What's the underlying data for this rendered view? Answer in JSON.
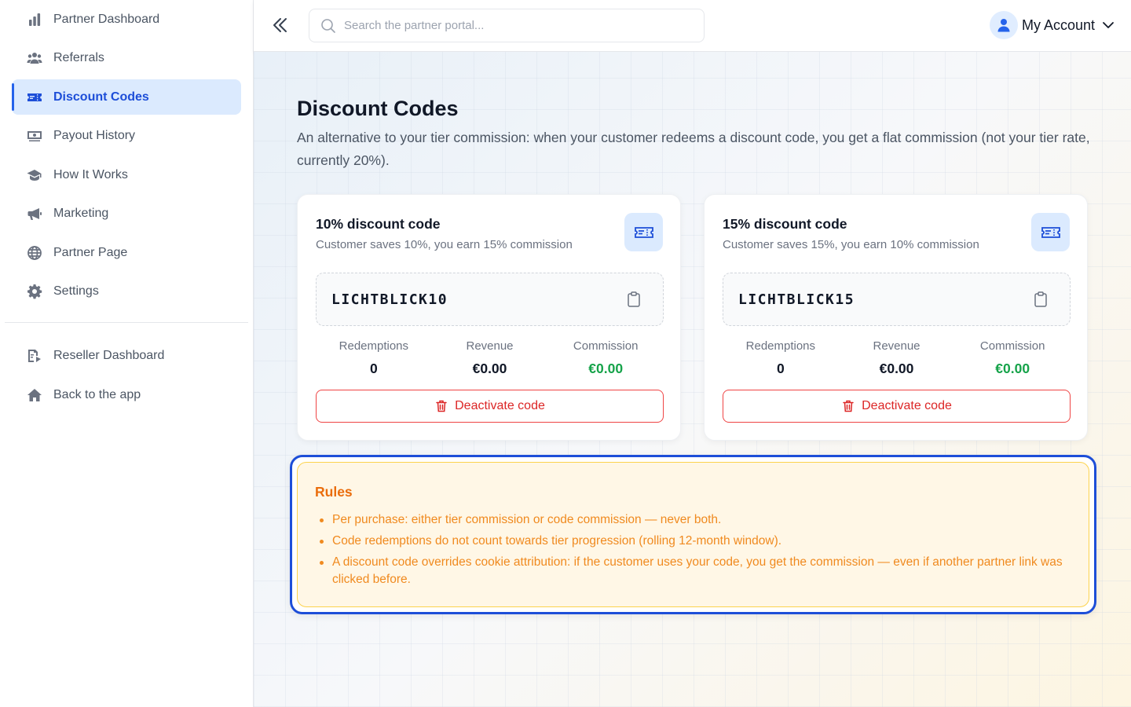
{
  "sidebar": {
    "items": [
      {
        "label": "Partner Dashboard"
      },
      {
        "label": "Referrals"
      },
      {
        "label": "Discount Codes"
      },
      {
        "label": "Payout History"
      },
      {
        "label": "How It Works"
      },
      {
        "label": "Marketing"
      },
      {
        "label": "Partner Page"
      },
      {
        "label": "Settings"
      }
    ],
    "secondary": [
      {
        "label": "Reseller Dashboard"
      },
      {
        "label": "Back to the app"
      }
    ]
  },
  "topbar": {
    "search_placeholder": "Search the partner portal...",
    "account_label": "My Account"
  },
  "page": {
    "title": "Discount Codes",
    "description": "An alternative to your tier commission: when your customer redeems a discount code, you get a flat commission (not your tier rate, currently 20%)."
  },
  "cards": [
    {
      "title": "10% discount code",
      "subtitle": "Customer saves 10%, you earn 15% commission",
      "code": "LICHTBLICK10",
      "redemptions_label": "Redemptions",
      "redemptions": "0",
      "revenue_label": "Revenue",
      "revenue": "€0.00",
      "commission_label": "Commission",
      "commission": "€0.00",
      "deactivate_label": "Deactivate code"
    },
    {
      "title": "15% discount code",
      "subtitle": "Customer saves 15%, you earn 10% commission",
      "code": "LICHTBLICK15",
      "redemptions_label": "Redemptions",
      "redemptions": "0",
      "revenue_label": "Revenue",
      "revenue": "€0.00",
      "commission_label": "Commission",
      "commission": "€0.00",
      "deactivate_label": "Deactivate code"
    }
  ],
  "rules": {
    "title": "Rules",
    "items": [
      "Per purchase: either tier commission or code commission — never both.",
      "Code redemptions do not count towards tier progression (rolling 12-month window).",
      "A discount code overrides cookie attribution: if the customer uses your code, you get the commission — even if another partner link was clicked before."
    ]
  },
  "colors": {
    "accent": "#1d4ed8",
    "active_bg": "#dbeafe",
    "danger": "#dc2626",
    "success": "#16a34a",
    "rules_text": "#f08a1f"
  }
}
